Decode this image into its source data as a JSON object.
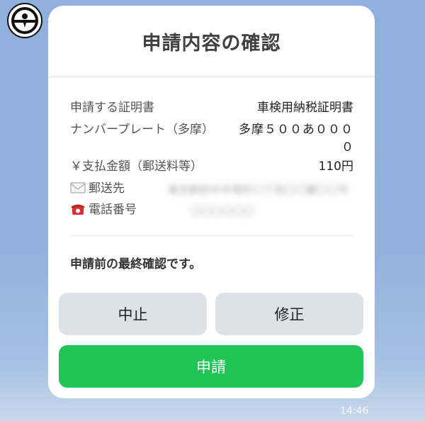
{
  "dialog": {
    "title": "申請内容の確認",
    "rows": [
      {
        "label": "申請する証明書",
        "value": "車検用納税証明書"
      },
      {
        "label": "ナンバープレート（多摩）",
        "value_line1": "多摩５００あ０００",
        "value_line2": "０"
      },
      {
        "label": "￥支払金額（郵送料等）",
        "value": "110円"
      },
      {
        "label": "郵送先",
        "value_blurred": "東京都府中市寿町〇丁目〇〇番〇〇号"
      },
      {
        "label": "電話番号",
        "value_blurred": "〇〇〇〇〇〇"
      }
    ],
    "notice": "申請前の最終確認です。",
    "buttons": {
      "cancel": "中止",
      "edit": "修正",
      "submit": "申請"
    }
  },
  "timestamp": "14:46",
  "colors": {
    "submit_green": "#21c456",
    "secondary_button": "#dfe1e8",
    "background_blue": "#8fb0dc"
  },
  "icons": [
    "avatar-logo-icon",
    "envelope-icon",
    "telephone-icon"
  ]
}
